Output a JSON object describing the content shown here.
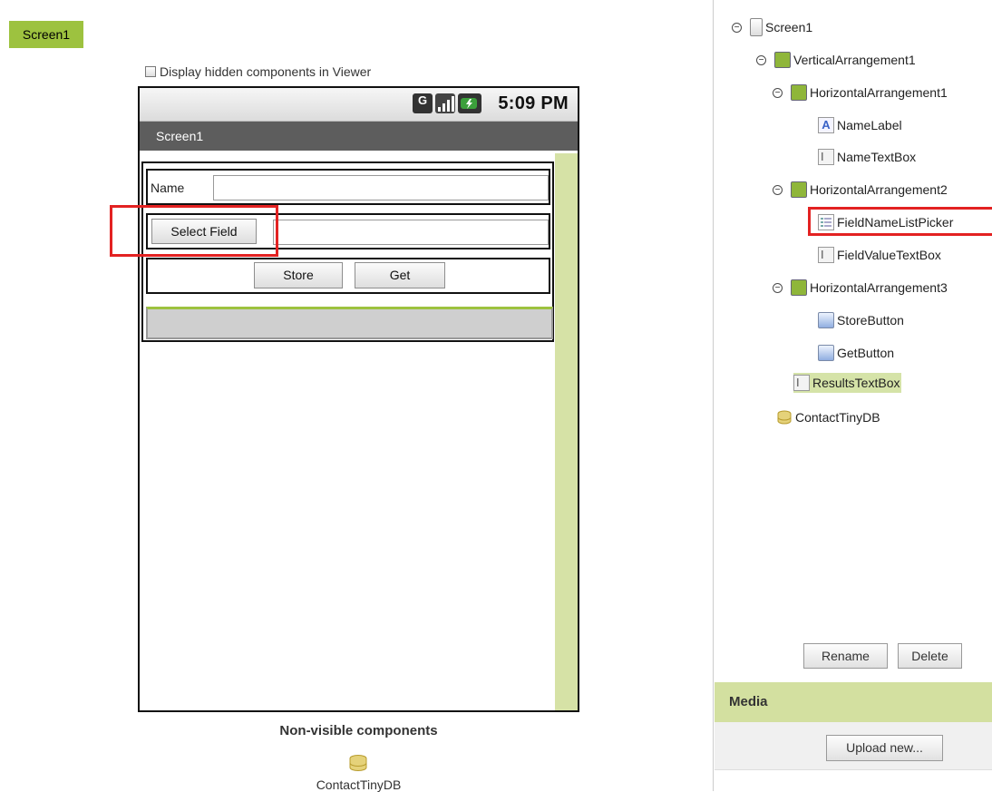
{
  "viewer": {
    "screen_tab": "Screen1",
    "hidden_checkbox_label": "Display hidden components in Viewer",
    "phone": {
      "status_time": "5:09 PM",
      "title": "Screen1",
      "name_label": "Name",
      "select_field_button": "Select Field",
      "store_button": "Store",
      "get_button": "Get"
    },
    "nonvisible_title": "Non-visible components",
    "nonvisible_item": "ContactTinyDB"
  },
  "tree": {
    "nodes": [
      {
        "label": "Screen1",
        "icon": "screen-icon"
      },
      {
        "label": "VerticalArrangement1",
        "icon": "vertical-arrangement-icon"
      },
      {
        "label": "HorizontalArrangement1",
        "icon": "horizontal-arrangement-icon"
      },
      {
        "label": "NameLabel",
        "icon": "label-icon"
      },
      {
        "label": "NameTextBox",
        "icon": "textbox-icon"
      },
      {
        "label": "HorizontalArrangement2",
        "icon": "horizontal-arrangement-icon"
      },
      {
        "label": "FieldNameListPicker",
        "icon": "listpicker-icon"
      },
      {
        "label": "FieldValueTextBox",
        "icon": "textbox-icon"
      },
      {
        "label": "HorizontalArrangement3",
        "icon": "horizontal-arrangement-icon"
      },
      {
        "label": "StoreButton",
        "icon": "button-icon"
      },
      {
        "label": "GetButton",
        "icon": "button-icon"
      },
      {
        "label": "ResultsTextBox",
        "icon": "textbox-icon"
      },
      {
        "label": "ContactTinyDB",
        "icon": "tinydb-icon"
      }
    ],
    "rename_button": "Rename",
    "delete_button": "Delete"
  },
  "media": {
    "header": "Media",
    "upload_button": "Upload new..."
  },
  "colors": {
    "accent_green": "#9dc23f",
    "highlight_red": "#e32222",
    "selected_bg": "#d5e3a8"
  }
}
